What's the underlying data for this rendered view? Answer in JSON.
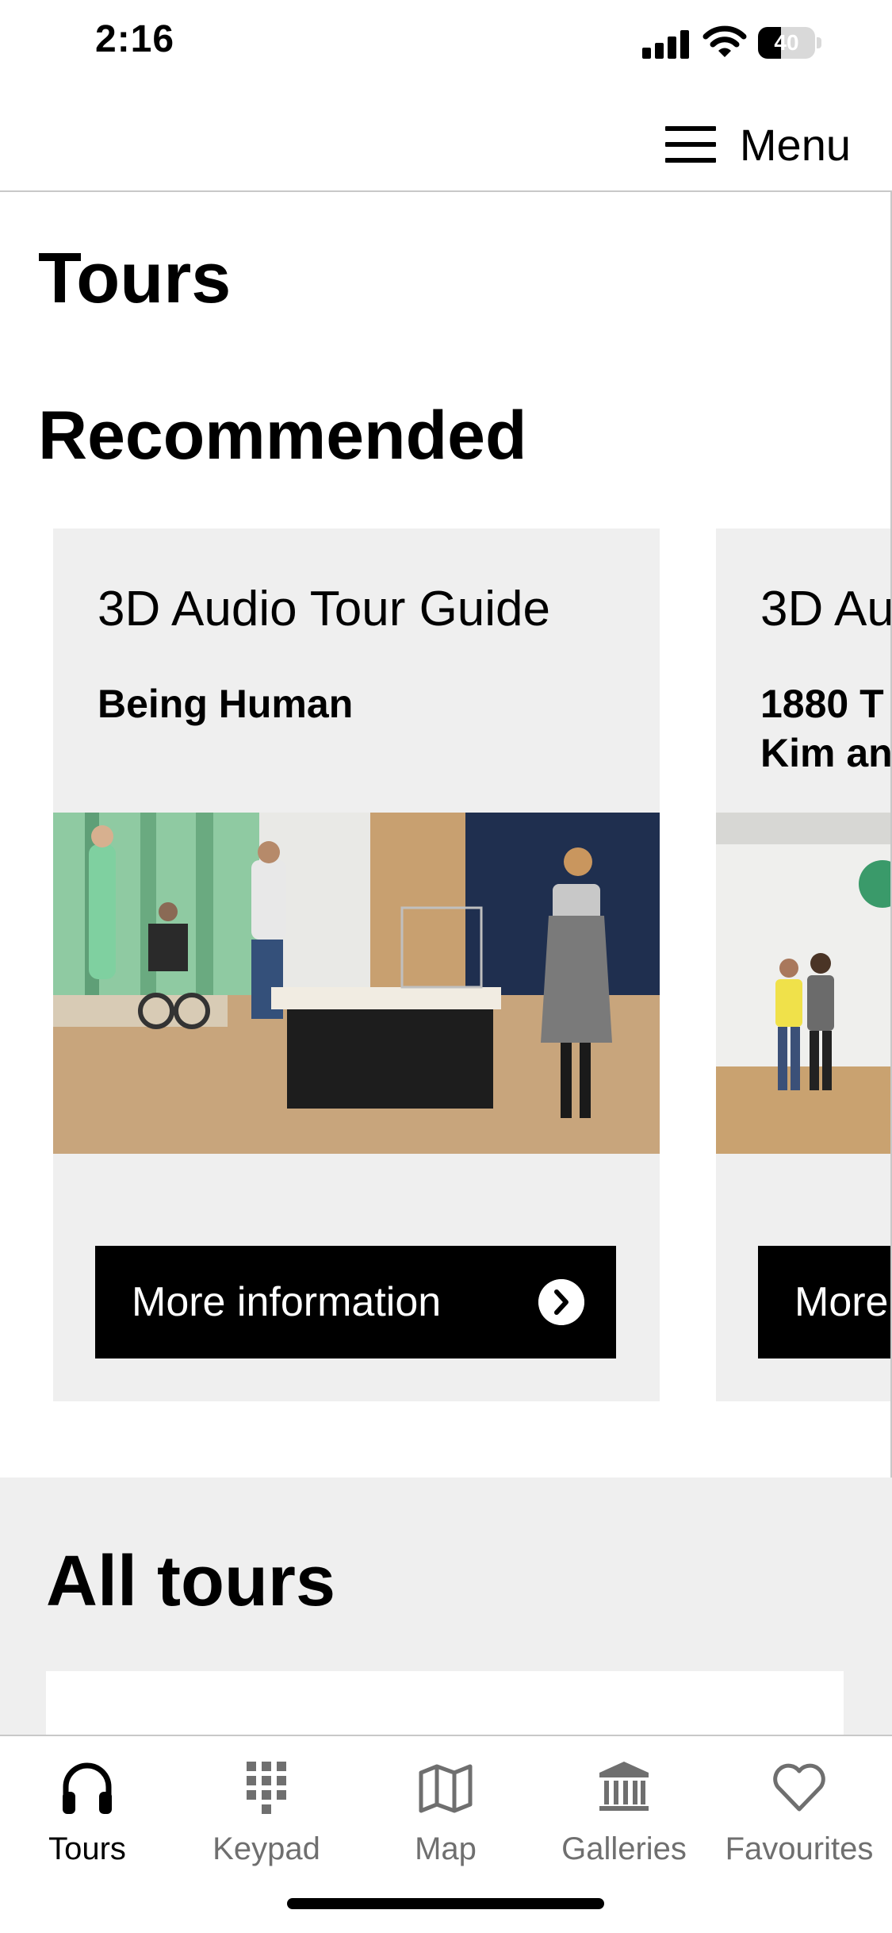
{
  "status_bar": {
    "time": "2:16",
    "battery": "40",
    "battery_level": 0.4
  },
  "header": {
    "menu_label": "Menu"
  },
  "page": {
    "title": "Tours"
  },
  "recommended": {
    "title": "Recommended",
    "cards": [
      {
        "tour_type": "3D Audio Tour Guide",
        "tour_name": "Being Human",
        "button_label": "More information"
      },
      {
        "tour_type": "3D Au",
        "tour_name": "1880 T\nKim an",
        "button_label": "More"
      }
    ]
  },
  "all_tours": {
    "title": "All tours"
  },
  "tab_bar": {
    "tabs": [
      {
        "label": "Tours",
        "icon": "headphones-icon",
        "active": true
      },
      {
        "label": "Keypad",
        "icon": "keypad-icon",
        "active": false
      },
      {
        "label": "Map",
        "icon": "map-icon",
        "active": false
      },
      {
        "label": "Galleries",
        "icon": "museum-icon",
        "active": false
      },
      {
        "label": "Favourites",
        "icon": "heart-icon",
        "active": false
      }
    ]
  },
  "colors": {
    "card_background": "#efefef",
    "button_background": "#000000",
    "inactive_tab": "#6f6f6f",
    "green_wall": "#7fbf95",
    "navy_wall": "#1f2f4f"
  }
}
